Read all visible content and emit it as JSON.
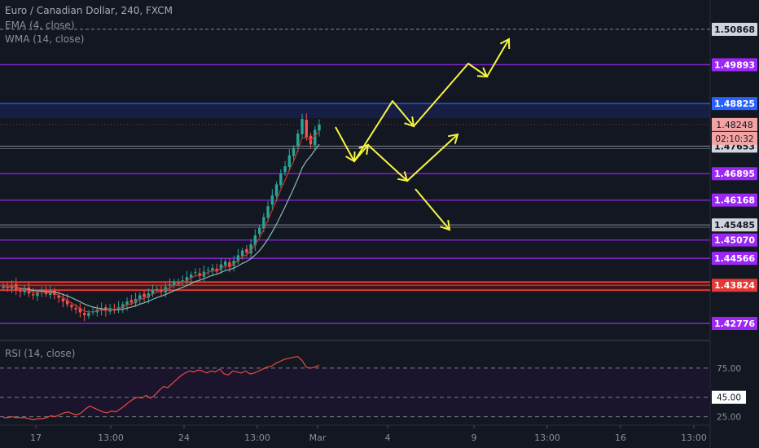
{
  "header": {
    "title": "Euro / Canadian Dollar, 240, FXCM",
    "indicator_1": "EMA (4, close)",
    "indicator_2": "WMA (14, close)"
  },
  "rsi_panel": {
    "title": "RSI (14, close)"
  },
  "colors": {
    "background": "#131722",
    "up_candle": "#26a69a",
    "down_candle": "#ef5350",
    "ema": "#c0392b",
    "wma": "#8fb8b0",
    "rsi_line": "#e74c3c",
    "arrows": "#f5f542",
    "purple": "#9c27f5",
    "blue": "#2962ff",
    "red": "#e53935",
    "gray": "#d1d4dc"
  },
  "chart_data": [
    {
      "type": "candlestick",
      "title": "Euro / Canadian Dollar, 240, FXCM",
      "ylim": [
        1.4235,
        1.5145
      ],
      "x_ticks": [
        "17",
        "13:00",
        "24",
        "13:00",
        "Mar",
        "4",
        "9",
        "13:00",
        "16",
        "13:00"
      ],
      "horizontal_levels": [
        {
          "label": "1.50868",
          "price": 1.50868,
          "color": "gray",
          "style": "dashed"
        },
        {
          "label": "1.49893",
          "price": 1.49893,
          "color": "purple",
          "style": "solid"
        },
        {
          "label": "1.48825",
          "price": 1.48825,
          "color": "blue",
          "style": "zone"
        },
        {
          "label": "1.47653",
          "price": 1.47653,
          "color": "gray",
          "style": "solid"
        },
        {
          "label": "1.46895",
          "price": 1.46895,
          "color": "purple",
          "style": "solid"
        },
        {
          "label": "1.46168",
          "price": 1.46168,
          "color": "purple",
          "style": "solid"
        },
        {
          "label": "1.45485",
          "price": 1.45485,
          "color": "gray",
          "style": "solid"
        },
        {
          "label": "1.45070",
          "price": 1.4507,
          "color": "purple",
          "style": "solid"
        },
        {
          "label": "1.44566",
          "price": 1.44566,
          "color": "purple",
          "style": "solid"
        },
        {
          "label": "1.43824",
          "price": 1.43824,
          "color": "red",
          "style": "zone"
        },
        {
          "label": "1.42776",
          "price": 1.42776,
          "color": "purple",
          "style": "solid"
        }
      ],
      "current_price": {
        "label": "1.48248",
        "price": 1.48248
      },
      "countdown": "02:10:32",
      "series_close": [
        1.438,
        1.4375,
        1.4382,
        1.437,
        1.4365,
        1.4372,
        1.436,
        1.4355,
        1.4362,
        1.4368,
        1.4358,
        1.4364,
        1.4356,
        1.4348,
        1.4338,
        1.433,
        1.4322,
        1.4316,
        1.4308,
        1.43,
        1.4306,
        1.431,
        1.4315,
        1.4318,
        1.4312,
        1.432,
        1.4314,
        1.4322,
        1.433,
        1.4338,
        1.4335,
        1.4345,
        1.4355,
        1.435,
        1.436,
        1.4368,
        1.4372,
        1.4365,
        1.4378,
        1.4385,
        1.4392,
        1.439,
        1.4396,
        1.4405,
        1.4412,
        1.4418,
        1.4408,
        1.442,
        1.4425,
        1.443,
        1.442,
        1.444,
        1.4448,
        1.4432,
        1.445,
        1.4465,
        1.4478,
        1.4472,
        1.4495,
        1.452,
        1.454,
        1.457,
        1.46,
        1.463,
        1.466,
        1.469,
        1.471,
        1.474,
        1.476,
        1.48,
        1.484,
        1.479,
        1.477,
        1.481,
        1.4825
      ],
      "rsi": {
        "type": "line",
        "levels": [
          {
            "label": "75.00",
            "value": 75
          },
          {
            "label": "45.00",
            "value": 45,
            "highlighted": true
          },
          {
            "label": "25.00",
            "value": 25
          }
        ],
        "ylim": [
          18,
          100
        ],
        "values": [
          24,
          24,
          25,
          24,
          24,
          24,
          23,
          22,
          23,
          23,
          24,
          26,
          25,
          27,
          29,
          30,
          28,
          27,
          29,
          33,
          36,
          34,
          32,
          30,
          29,
          31,
          30,
          33,
          36,
          40,
          43,
          45,
          44,
          47,
          44,
          47,
          52,
          56,
          55,
          59,
          63,
          67,
          70,
          72,
          71,
          73,
          72,
          70,
          72,
          71,
          74,
          69,
          68,
          72,
          71,
          70,
          72,
          69,
          70,
          72,
          74,
          76,
          77,
          80,
          82,
          84,
          85,
          86,
          87,
          83,
          76,
          75,
          76,
          78
        ]
      },
      "annotations": [
        {
          "type": "arrow-paths",
          "description": "yellow projected zigzag paths"
        }
      ]
    }
  ]
}
